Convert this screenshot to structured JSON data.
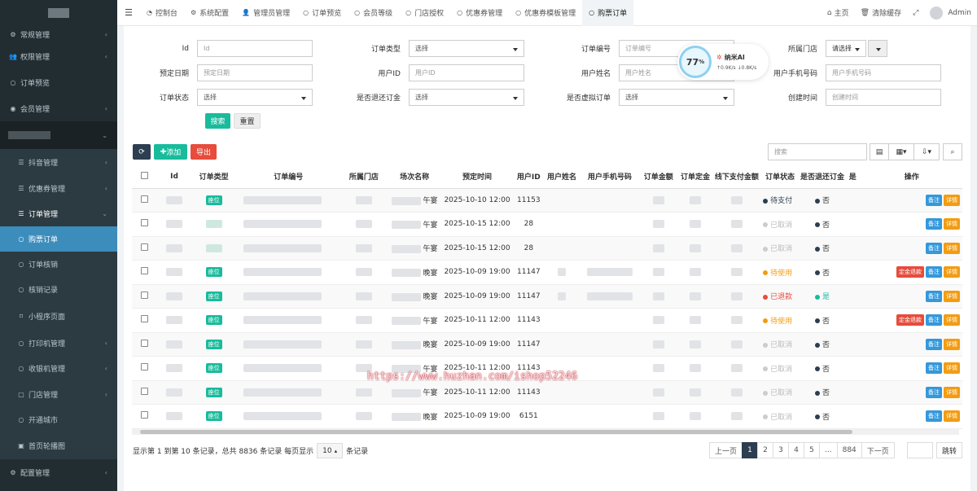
{
  "sidebar": {
    "items": [
      {
        "label": "常规管理",
        "icon": "cogs-icon",
        "glyph": "⚙",
        "arrow": "‹",
        "type": "top"
      },
      {
        "label": "权限管理",
        "icon": "group-icon",
        "glyph": "👥",
        "arrow": "‹",
        "type": "top"
      },
      {
        "label": "订单预览",
        "icon": "circle-icon",
        "glyph": "○",
        "arrow": "",
        "type": "top"
      },
      {
        "label": "会员管理",
        "icon": "user-circle-icon",
        "glyph": "◉",
        "arrow": "‹",
        "type": "top"
      },
      {
        "label": "",
        "icon": "blurred-icon",
        "glyph": "",
        "arrow": "⌄",
        "type": "blurred"
      },
      {
        "label": "抖音管理",
        "icon": "list-icon",
        "glyph": "☰",
        "arrow": "‹",
        "type": "sub"
      },
      {
        "label": "优惠券管理",
        "icon": "list-icon",
        "glyph": "☰",
        "arrow": "‹",
        "type": "sub"
      },
      {
        "label": "订单管理",
        "icon": "list-icon",
        "glyph": "☰",
        "arrow": "⌄",
        "type": "sub-open"
      },
      {
        "label": "购票订单",
        "icon": "circle-icon",
        "glyph": "○",
        "arrow": "",
        "type": "active"
      },
      {
        "label": "订单核销",
        "icon": "circle-icon",
        "glyph": "○",
        "arrow": "",
        "type": "subsub"
      },
      {
        "label": "核销记录",
        "icon": "circle-icon",
        "glyph": "○",
        "arrow": "",
        "type": "subsub"
      },
      {
        "label": "小程序页面",
        "icon": "bookmark-icon",
        "glyph": "⌑",
        "arrow": "",
        "type": "sub"
      },
      {
        "label": "打印机管理",
        "icon": "circle-icon",
        "glyph": "○",
        "arrow": "‹",
        "type": "sub"
      },
      {
        "label": "收银机管理",
        "icon": "circle-icon",
        "glyph": "○",
        "arrow": "‹",
        "type": "sub"
      },
      {
        "label": "门店管理",
        "icon": "file-icon",
        "glyph": "▢",
        "arrow": "‹",
        "type": "sub"
      },
      {
        "label": "开通城市",
        "icon": "circle-icon",
        "glyph": "○",
        "arrow": "",
        "type": "sub"
      },
      {
        "label": "首页轮播图",
        "icon": "image-icon",
        "glyph": "▣",
        "arrow": "",
        "type": "sub"
      },
      {
        "label": "配置管理",
        "icon": "cogs-icon",
        "glyph": "⚙",
        "arrow": "‹",
        "type": "top"
      }
    ]
  },
  "topbar": {
    "tabs": [
      {
        "label": "控制台",
        "glyph": "◔"
      },
      {
        "label": "系统配置",
        "glyph": "⚙"
      },
      {
        "label": "管理员管理",
        "glyph": "👤"
      },
      {
        "label": "订单预览",
        "glyph": "○"
      },
      {
        "label": "会员等级",
        "glyph": "○"
      },
      {
        "label": "门店授权",
        "glyph": "○"
      },
      {
        "label": "优惠券管理",
        "glyph": "○"
      },
      {
        "label": "优惠券模板管理",
        "glyph": "○"
      },
      {
        "label": "购票订单",
        "glyph": "○"
      }
    ],
    "home": "主页",
    "clear_cache": "清除缓存",
    "user": "Admin"
  },
  "filters": {
    "rows": [
      [
        {
          "label": "Id",
          "placeholder": "Id",
          "type": "input"
        },
        {
          "label": "订单类型",
          "placeholder": "选择",
          "type": "select"
        },
        {
          "label": "订单编号",
          "placeholder": "订单编号",
          "type": "input"
        },
        {
          "label": "所属门店",
          "placeholder": "请选择",
          "type": "store"
        }
      ],
      [
        {
          "label": "预定日期",
          "placeholder": "预定日期",
          "type": "input"
        },
        {
          "label": "用户ID",
          "placeholder": "用户ID",
          "type": "input"
        },
        {
          "label": "用户姓名",
          "placeholder": "用户姓名",
          "type": "input"
        },
        {
          "label": "用户手机号码",
          "placeholder": "用户手机号码",
          "type": "input"
        }
      ],
      [
        {
          "label": "订单状态",
          "placeholder": "选择",
          "type": "select"
        },
        {
          "label": "是否退还订金",
          "placeholder": "选择",
          "type": "select"
        },
        {
          "label": "是否虚拟订单",
          "placeholder": "选择",
          "type": "select"
        },
        {
          "label": "创建时间",
          "placeholder": "创建时间",
          "type": "input"
        }
      ]
    ],
    "search_label": "搜索",
    "reset_label": "重置"
  },
  "net_widget": {
    "percent": "77",
    "unit": "%",
    "name": "纳米AI",
    "up": "0.9K/s",
    "down": "0.8K/s"
  },
  "toolbar": {
    "add_label": "添加",
    "export_label": "导出",
    "search_placeholder": "搜索"
  },
  "table": {
    "columns": [
      "Id",
      "订单类型",
      "订单编号",
      "所属门店",
      "场次名称",
      "预定时间",
      "用户ID",
      "用户姓名",
      "用户手机号码",
      "订单金额",
      "订单定金",
      "线下支付金额",
      "订单状态",
      "是否退还订金",
      "是",
      "操作"
    ],
    "rows": [
      {
        "session": "午宴",
        "time": "2025-10-10 12:00",
        "uid": "11153",
        "status": "待支付",
        "status_color": "#2c3e50",
        "refund": "否",
        "refund_color": "#2c3e50",
        "ops": [
          "备注",
          "详情"
        ],
        "tag": true
      },
      {
        "session": "午宴",
        "time": "2025-10-15 12:00",
        "uid": "28",
        "status": "已取消",
        "status_color": "#ccc",
        "refund": "否",
        "refund_color": "#2c3e50",
        "ops": [
          "备注",
          "详情"
        ],
        "tag": false
      },
      {
        "session": "午宴",
        "time": "2025-10-15 12:00",
        "uid": "28",
        "status": "已取消",
        "status_color": "#ccc",
        "refund": "否",
        "refund_color": "#2c3e50",
        "ops": [
          "备注",
          "详情"
        ],
        "tag": false
      },
      {
        "session": "晚宴",
        "time": "2025-10-09 19:00",
        "uid": "11147",
        "status": "待使用",
        "status_color": "#f39c12",
        "refund": "否",
        "refund_color": "#2c3e50",
        "ops": [
          "定金退款",
          "备注",
          "详情"
        ],
        "tag": true
      },
      {
        "session": "晚宴",
        "time": "2025-10-09 19:00",
        "uid": "11147",
        "status": "已退款",
        "status_color": "#e74c3c",
        "refund": "是",
        "refund_color": "#18bc9c",
        "ops": [
          "备注",
          "详情"
        ],
        "tag": true
      },
      {
        "session": "午宴",
        "time": "2025-10-11 12:00",
        "uid": "11143",
        "status": "待使用",
        "status_color": "#f39c12",
        "refund": "否",
        "refund_color": "#2c3e50",
        "ops": [
          "定金退款",
          "备注",
          "详情"
        ],
        "tag": true
      },
      {
        "session": "晚宴",
        "time": "2025-10-09 19:00",
        "uid": "11147",
        "status": "已取消",
        "status_color": "#ccc",
        "refund": "否",
        "refund_color": "#2c3e50",
        "ops": [
          "备注",
          "详情"
        ],
        "tag": true
      },
      {
        "session": "午宴",
        "time": "2025-10-11 12:00",
        "uid": "11143",
        "status": "已取消",
        "status_color": "#ccc",
        "refund": "否",
        "refund_color": "#2c3e50",
        "ops": [
          "备注",
          "详情"
        ],
        "tag": true
      },
      {
        "session": "午宴",
        "time": "2025-10-11 12:00",
        "uid": "11143",
        "status": "已取消",
        "status_color": "#ccc",
        "refund": "否",
        "refund_color": "#2c3e50",
        "ops": [
          "备注",
          "详情"
        ],
        "tag": true
      },
      {
        "session": "晚宴",
        "time": "2025-10-09 19:00",
        "uid": "6151",
        "status": "已取消",
        "status_color": "#ccc",
        "refund": "否",
        "refund_color": "#2c3e50",
        "ops": [
          "备注",
          "详情"
        ],
        "tag": true
      }
    ],
    "tag_label": "座位"
  },
  "footer": {
    "summary_prefix": "显示第 1 到第 10 条记录，总共 8836 条记录 每页显示",
    "page_size": "10",
    "summary_suffix": "条记录",
    "pages": [
      "上一页",
      "1",
      "2",
      "3",
      "4",
      "5",
      "...",
      "884",
      "下一页"
    ],
    "current_page": "1",
    "jump_label": "跳转"
  },
  "watermark": "https://www.huzhan.com/ishop52246",
  "colors": {
    "sidebar_bg": "#222d32",
    "active": "#3c8dbc",
    "primary": "#18bc9c",
    "danger": "#e74c3c",
    "warning": "#f39c12",
    "info": "#3498db",
    "dark": "#2c3e50"
  }
}
